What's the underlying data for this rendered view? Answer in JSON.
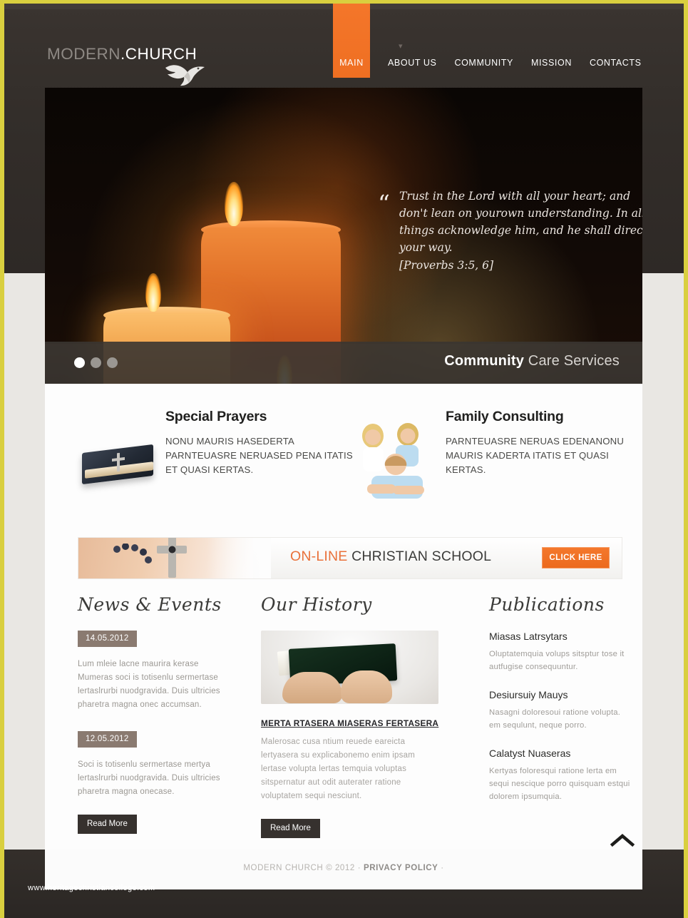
{
  "site": {
    "logo_modern": "MODERN",
    "logo_dot": ".",
    "logo_church": "CHURCH",
    "accent_orange": "#ef6f22",
    "frame_yellow": "#d9cf3f"
  },
  "nav": {
    "items": [
      {
        "label": "MAIN",
        "active": true
      },
      {
        "label": "ABOUT US",
        "active": false
      },
      {
        "label": "COMMUNITY",
        "active": false
      },
      {
        "label": "MISSION",
        "active": false
      },
      {
        "label": "CONTACTS",
        "active": false
      }
    ],
    "caret_icon": "chevron-down-icon"
  },
  "slider": {
    "quote_open": "“",
    "quote_close": "”",
    "quote": "Trust in the Lord with all your heart; and don't lean on yourown understanding. In all things acknowledge him, and he shall direct your way.",
    "reference": "[Proverbs 3:5, 6]",
    "caption_bold": "Community",
    "caption_normal": " Care Services",
    "dots": [
      {
        "active": true
      },
      {
        "active": false
      },
      {
        "active": false
      }
    ]
  },
  "services": [
    {
      "title": "Special Prayers",
      "icon": "bible-book-icon",
      "body": "NONU MAURIS HASEDERTA PARNTEUASRE NERUASED PENA ITATIS ET QUASI KERTAS."
    },
    {
      "title": "Family Consulting",
      "icon": "family-photo-icon",
      "body": "PARNTEUASRE NERUAS EDENANONU MAURIS KADERTA ITATIS ET QUASI KERTAS."
    }
  ],
  "banner": {
    "title_orange": "ON-LINE",
    "title_dark": " CHRISTIAN SCHOOL",
    "button_label": "CLICK HERE",
    "photo_icon": "cross-necklace-icon"
  },
  "news": {
    "heading": "News & Events",
    "items": [
      {
        "date": "14.05.2012",
        "text": "Lum mleie lacne maurira kerase Mumeras soci is totisenlu sermertase lertaslrurbi nuodgravida. Duis ultricies pharetra magna onec accumsan."
      },
      {
        "date": "12.05.2012",
        "text": "Soci is totisenlu sermertase mertya lertaslrurbi nuodgravida. Duis ultricies pharetra magna onecase."
      }
    ],
    "read_more": "Read More"
  },
  "history": {
    "heading": "Our History",
    "image_icon": "hands-holding-prayer-book-image",
    "title": "MERTA RTASERA MIASERAS FERTASERA",
    "text": "Malerosac cusa ntium reuede eareicta lertyasera su explicabonemo enim ipsam lertase volupta lertas temquia voluptas sitspernatur aut odit auterater ratione voluptatem sequi nesciunt.",
    "read_more": "Read More"
  },
  "publications": {
    "heading": "Publications",
    "items": [
      {
        "title": "Miasas Latrsytars",
        "text": "Oluptatemquia volups sitsptur tose it autfugise consequuntur."
      },
      {
        "title": "Desiursuiy Mauys",
        "text": "Nasagni doloresoui ratione volupta. em sequlunt, neque porro."
      },
      {
        "title": "Calatyst Nuaseras",
        "text": "Kertyas foloresqui ratione lerta em sequi nescique porro quisquam estqui dolorem ipsumquia."
      }
    ]
  },
  "footer": {
    "copyright": "MODERN CHURCH © 2012 · ",
    "privacy": "PRIVACY POLICY",
    "trailing": " ·"
  },
  "watermark": "www.heritagechristiancollege.com",
  "to_top_icon": "chevron-up-icon"
}
